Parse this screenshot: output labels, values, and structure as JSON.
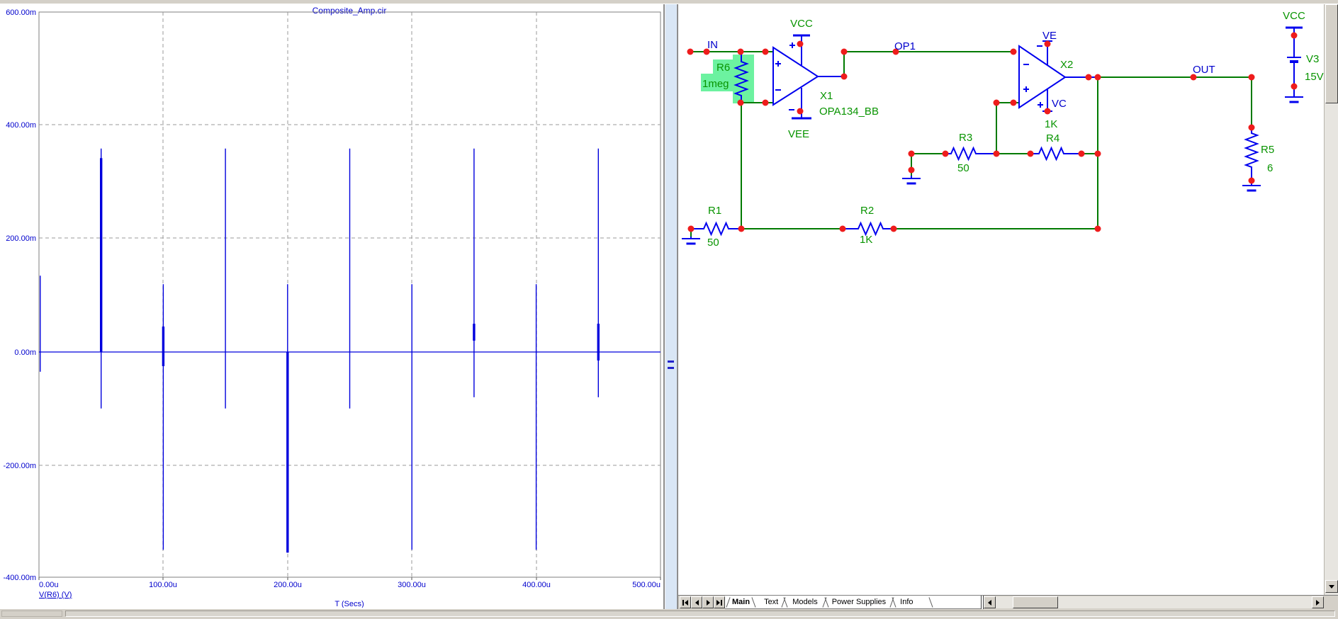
{
  "plot": {
    "title": "Composite_Amp.cir",
    "legend": "V(R6) (V)",
    "x_title": "T (Secs)",
    "y_ticks": [
      "600.00m",
      "400.00m",
      "200.00m",
      "0.00m",
      "-200.00m",
      "-400.00m"
    ],
    "x_ticks": [
      "0.00u",
      "100.00u",
      "200.00u",
      "300.00u",
      "400.00u",
      "500.00u"
    ]
  },
  "chart_data": {
    "type": "line",
    "title": "Composite_Amp.cir",
    "xlabel": "T (Secs)",
    "series_name": "V(R6) (V)",
    "x_unit": "microseconds",
    "y_unit": "millivolts",
    "xlim_u": [
      0,
      500
    ],
    "ylim_m": [
      -400,
      600
    ],
    "x_gridlines_u": [
      100,
      200,
      300,
      400
    ],
    "y_gridlines_m": [
      400,
      200,
      0,
      -200
    ],
    "grid_style": "dashed",
    "baseline_m": 0,
    "trace_color": "#0000dd",
    "spikes": [
      {
        "t_u": 1,
        "peak_m": 135,
        "trough_m": -35,
        "bold_segment_m": null
      },
      {
        "t_u": 50,
        "peak_m": 360,
        "trough_m": -100,
        "bold_segment_m": [
          343,
          0
        ]
      },
      {
        "t_u": 100,
        "peak_m": 120,
        "trough_m": -350,
        "bold_segment_m": [
          45,
          -25
        ]
      },
      {
        "t_u": 150,
        "peak_m": 360,
        "trough_m": -100,
        "bold_segment_m": null
      },
      {
        "t_u": 200,
        "peak_m": 120,
        "trough_m": -355,
        "bold_segment_m": [
          0,
          -355
        ]
      },
      {
        "t_u": 250,
        "peak_m": 360,
        "trough_m": -100,
        "bold_segment_m": null
      },
      {
        "t_u": 300,
        "peak_m": 120,
        "trough_m": -350,
        "bold_segment_m": null
      },
      {
        "t_u": 350,
        "peak_m": 360,
        "trough_m": -80,
        "bold_segment_m": [
          50,
          20
        ]
      },
      {
        "t_u": 400,
        "peak_m": 120,
        "trough_m": -350,
        "bold_segment_m": null
      },
      {
        "t_u": 450,
        "peak_m": 360,
        "trough_m": -80,
        "bold_segment_m": [
          50,
          -15
        ]
      }
    ]
  },
  "schematic": {
    "labels": {
      "in": "IN",
      "op1": "OP1",
      "out": "OUT",
      "vcc_x1": "VCC",
      "vee_x1": "VEE",
      "ve": "VE",
      "vc": "VC",
      "x1_ref": "X1",
      "x1_model": "OPA134_BB",
      "x2_ref": "X2",
      "r1_ref": "R1",
      "r1_val": "50",
      "r2_ref": "R2",
      "r2_val": "1K",
      "r3_ref": "R3",
      "r3_val": "50",
      "r4_ref": "R4",
      "r4_val": "1K",
      "r5_ref": "R5",
      "r5_val": "6",
      "r6_ref": "R6",
      "r6_val": "1meg",
      "v3_rail": "VCC",
      "v3_ref": "V3",
      "v3_val": "15V"
    },
    "colors": {
      "wire": "#007a00",
      "component": "#0000ee",
      "junction": "#ee1c1c",
      "label_green": "#089400",
      "label_blue": "#0000cd",
      "highlight": "#6cf2a0"
    }
  },
  "tabs": {
    "items": [
      {
        "label": "Main",
        "active": true
      },
      {
        "label": "Text",
        "active": false
      },
      {
        "label": "Models",
        "active": false
      },
      {
        "label": "Power Supplies",
        "active": false
      },
      {
        "label": "Info",
        "active": false
      }
    ]
  }
}
